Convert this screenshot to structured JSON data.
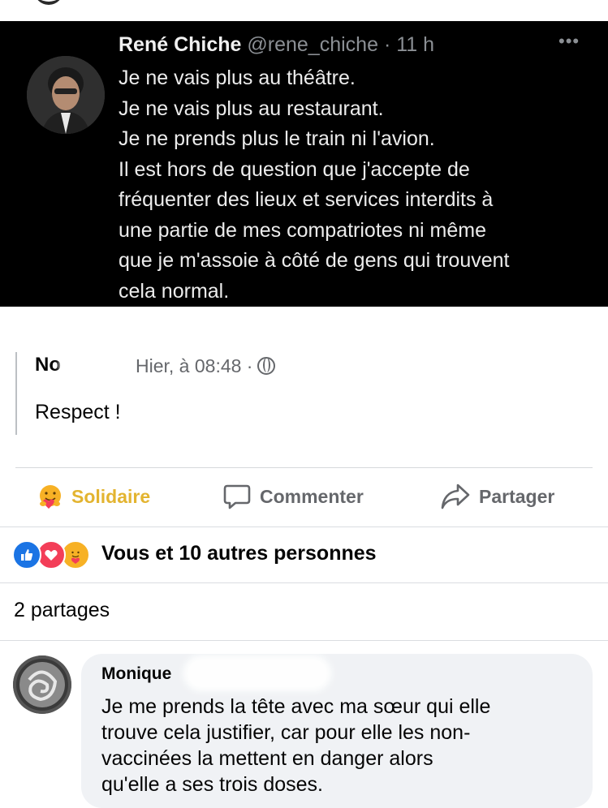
{
  "tweet": {
    "name": "René Chiche",
    "handle": "@rene_chiche",
    "separator": "·",
    "time": "11 h",
    "more": "•••",
    "lines": [
      "Je ne vais plus au théâtre.",
      "Je ne vais plus au restaurant.",
      "Je ne prends plus le train ni l'avion.",
      "Il est hors de question que j'accepte de",
      "fréquenter des lieux et services interdits à",
      "une partie de mes compatriotes ni même",
      "que je m'assoie à côté de gens qui trouvent",
      "cela normal."
    ]
  },
  "shared_post": {
    "author": "No",
    "meta": "Hier, à 08:48 ·",
    "body": "Respect !"
  },
  "actions": {
    "solidaire": "Solidaire",
    "comment": "Commenter",
    "share": "Partager"
  },
  "reactions": {
    "icons": [
      "like-icon",
      "love-icon",
      "care-icon"
    ],
    "summary": "Vous et 10 autres personnes"
  },
  "shares": "2 partages",
  "comment": {
    "author": "Monique",
    "lines": [
      "Je me prends la tête avec ma sœur qui elle",
      "trouve cela justifier, car pour elle les non-",
      "vaccinées la mettent en danger alors",
      "qu'elle a ses trois doses."
    ]
  },
  "colors": {
    "tweet_bg": "#000000",
    "solidaire": "#e3b430",
    "like": "#1b74e4",
    "love": "#f33e58",
    "muted": "#65676b"
  }
}
